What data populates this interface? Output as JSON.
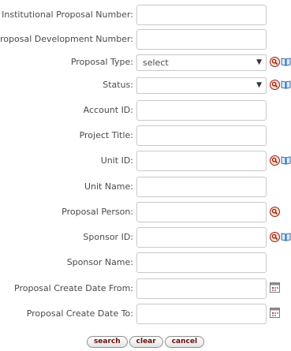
{
  "fields": {
    "institutional_proposal_number": {
      "label": "Institutional Proposal Number:",
      "value": ""
    },
    "proposal_development_number": {
      "label": "Proposal Development Number:",
      "value": ""
    },
    "proposal_type": {
      "label": "Proposal Type:",
      "selected": "select"
    },
    "status": {
      "label": "Status:",
      "selected": ""
    },
    "account_id": {
      "label": "Account ID:",
      "value": ""
    },
    "project_title": {
      "label": "Project Title:",
      "value": ""
    },
    "unit_id": {
      "label": "Unit ID:",
      "value": ""
    },
    "unit_name": {
      "label": "Unit Name:",
      "value": ""
    },
    "proposal_person": {
      "label": "Proposal Person:",
      "value": ""
    },
    "sponsor_id": {
      "label": "Sponsor ID:",
      "value": ""
    },
    "sponsor_name": {
      "label": "Sponsor Name:",
      "value": ""
    },
    "create_date_from": {
      "label": "Proposal Create Date From:",
      "value": ""
    },
    "create_date_to": {
      "label": "Proposal Create Date To:",
      "value": ""
    }
  },
  "icons": {
    "lookup": "magnifier-lookup-icon",
    "direct_inquiry": "book-inquiry-icon",
    "calendar": "calendar-icon"
  },
  "buttons": {
    "search": "search",
    "clear": "clear",
    "cancel": "cancel"
  },
  "colors": {
    "button_text": "#6b0f0f",
    "lookup_icon": "#a11b1b",
    "book_icon": "#2f6fb3"
  }
}
